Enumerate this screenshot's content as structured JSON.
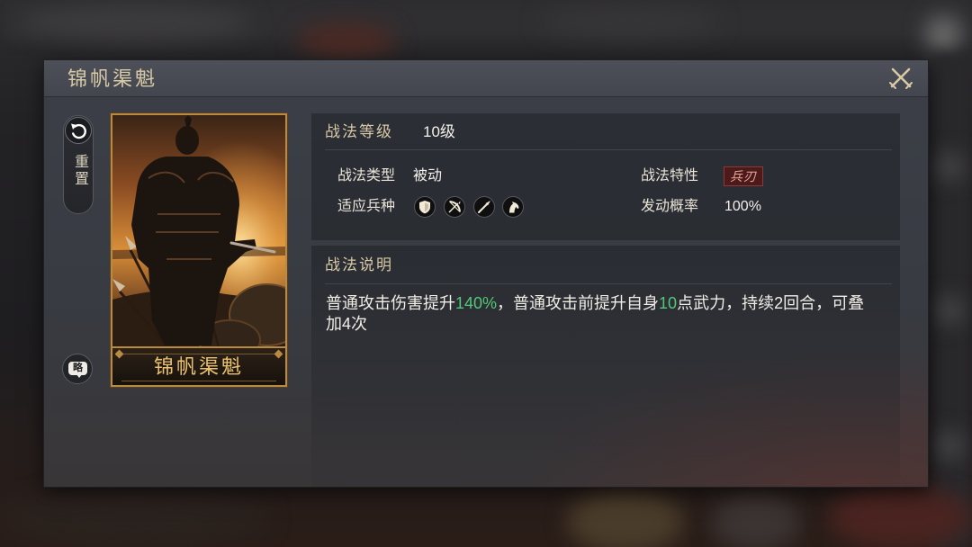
{
  "dialog": {
    "title": "锦帆渠魁",
    "close_icon": "close-icon"
  },
  "side": {
    "reset_icon": "undo-icon",
    "reset_label": "重置",
    "strategy_icon": "speech-bubble-icon",
    "strategy_label": "略"
  },
  "card": {
    "name": "锦帆渠魁"
  },
  "info": {
    "level_label": "战法等级",
    "level_value": "10级",
    "type_label": "战法类型",
    "type_value": "被动",
    "trait_label": "战法特性",
    "trait_value": "兵刃",
    "troops_label": "适应兵种",
    "troop_icons": [
      "shield-icon",
      "bow-icon",
      "spear-icon",
      "horse-icon"
    ],
    "rate_label": "发动概率",
    "rate_value": "100%"
  },
  "description": {
    "title": "战法说明",
    "lines": [
      [
        "普通攻击伤害提升",
        "140%",
        "，普通攻击前提升自身",
        "10",
        "点武力，持续2回合，可叠"
      ],
      [
        "加4次"
      ]
    ]
  },
  "colors": {
    "title_gold": "#d8c9a6",
    "card_gold": "#ecc26c",
    "highlight_green": "#52c878",
    "trait_badge": "#4c1a1a",
    "panel_bg": "#383b42"
  }
}
